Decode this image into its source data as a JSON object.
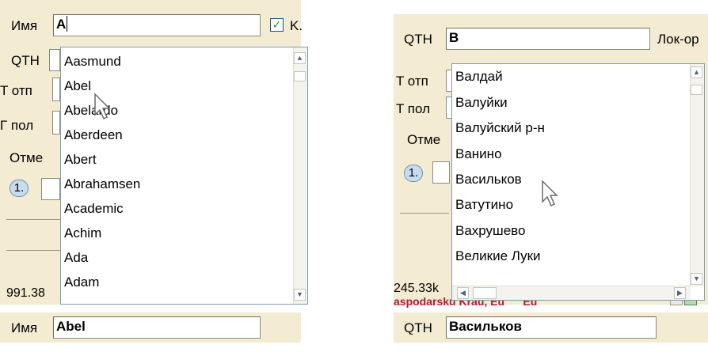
{
  "left": {
    "name_label": "Имя",
    "name_value": "A",
    "checkbox_mark": "✓",
    "checkbox_label_partial": "K.",
    "rows": [
      "QTH",
      "T отп",
      "Г пол",
      "Отме"
    ],
    "badge": "1.",
    "footer_number": "991.38",
    "list_items": [
      "Aasmund",
      "Abel",
      "Abelardo",
      "Aberdeen",
      "Abert",
      "Abrahamsen",
      "Academic",
      "Achim",
      "Ada",
      "Adam"
    ]
  },
  "right": {
    "qth_label": "QTH",
    "qth_value": "В",
    "locator_label_partial": "Лок-ор",
    "rows": [
      "T отп",
      "T пол",
      "Отме"
    ],
    "badge": "1.",
    "footer_number": "245.33k",
    "footer_red_text": "aspodarsku Krau, Eu      Eu",
    "list_items": [
      "Валдай",
      "Валуйки",
      "Валуйский р-н",
      "Ванино",
      "Васильков",
      "Ватутино",
      "Вахрушево",
      "Великие Луки"
    ]
  },
  "bottom_left": {
    "label": "Имя",
    "value": "Abel"
  },
  "bottom_right": {
    "label": "QTH",
    "value": "Васильков"
  },
  "icons": {
    "scroll_up": "▲",
    "scroll_down": "▼",
    "scroll_left": "◀",
    "scroll_right": "▶"
  }
}
